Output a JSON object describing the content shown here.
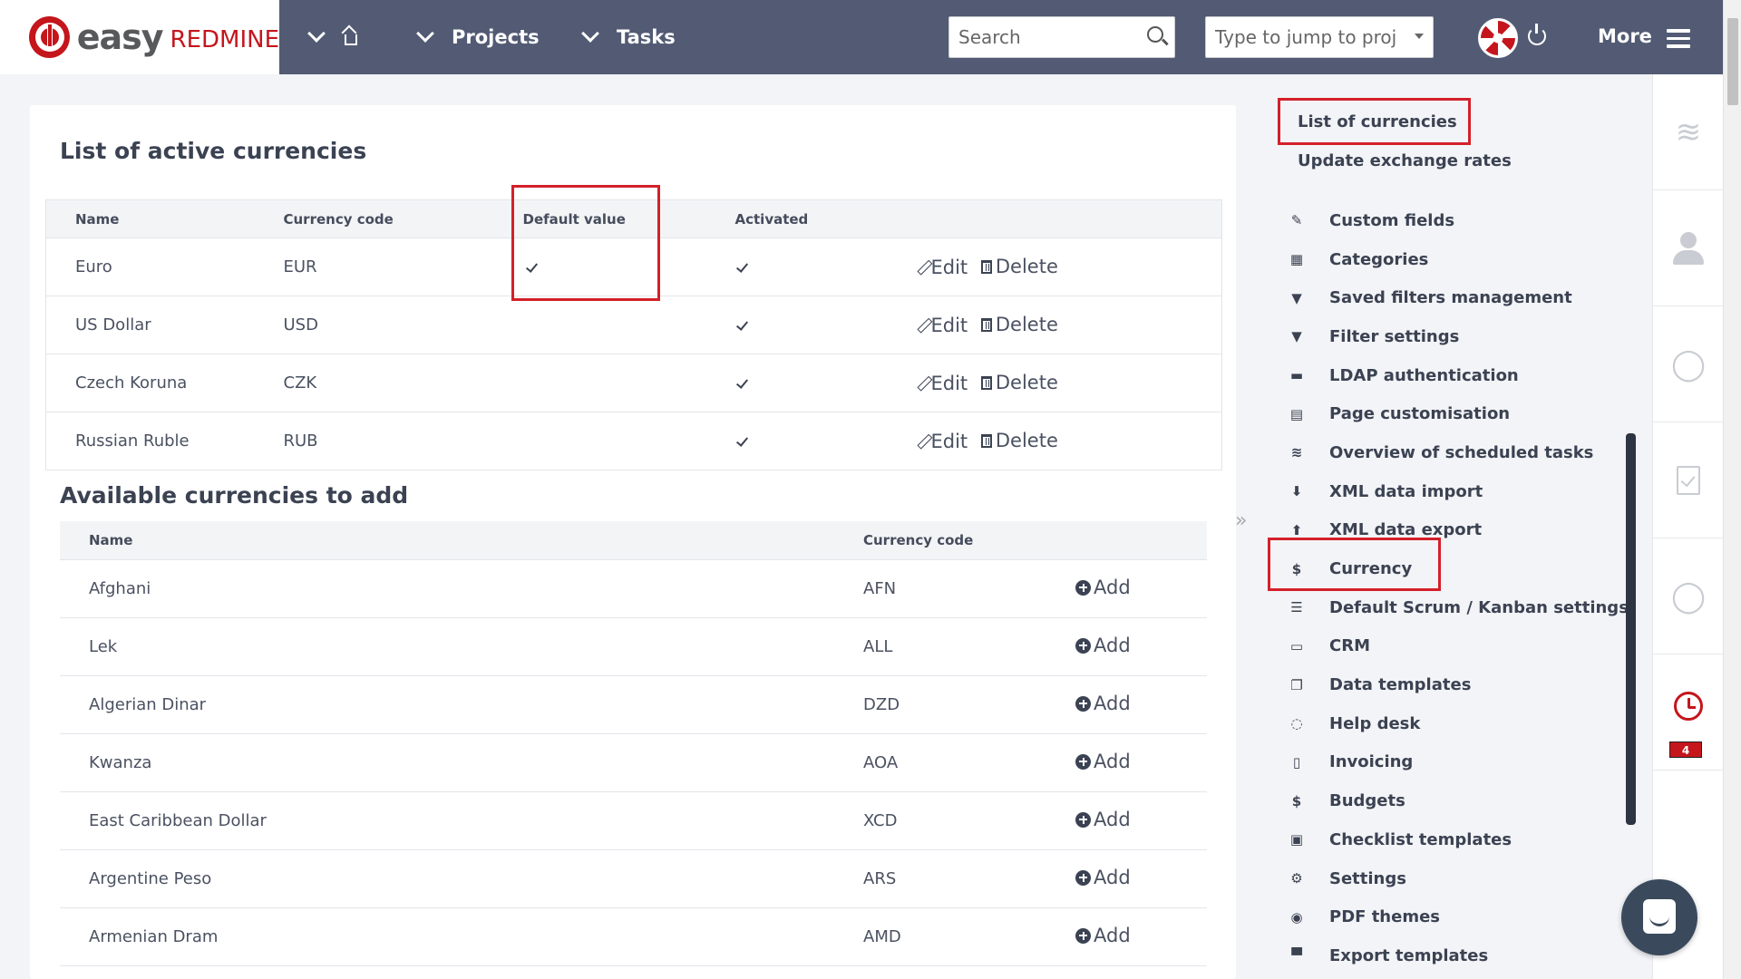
{
  "header": {
    "logo_text_easy": "easy",
    "logo_text_redmine": "REDMINE",
    "nav": [
      {
        "label": "Projects"
      },
      {
        "label": "Tasks"
      }
    ],
    "search_placeholder": "Search",
    "jump_placeholder": "Type to jump to project...",
    "more_label": "More"
  },
  "active_currencies": {
    "title": "List of active currencies",
    "columns": {
      "name": "Name",
      "code": "Currency code",
      "default": "Default value",
      "activated": "Activated"
    },
    "rows": [
      {
        "name": "Euro",
        "code": "EUR",
        "default": true,
        "activated": true
      },
      {
        "name": "US Dollar",
        "code": "USD",
        "default": false,
        "activated": true
      },
      {
        "name": "Czech Koruna",
        "code": "CZK",
        "default": false,
        "activated": true
      },
      {
        "name": "Russian Ruble",
        "code": "RUB",
        "default": false,
        "activated": true
      }
    ],
    "edit_label": "Edit",
    "delete_label": "Delete"
  },
  "available_currencies": {
    "title": "Available currencies to add",
    "columns": {
      "name": "Name",
      "code": "Currency code"
    },
    "rows": [
      {
        "name": "Afghani",
        "code": "AFN"
      },
      {
        "name": "Lek",
        "code": "ALL"
      },
      {
        "name": "Algerian Dinar",
        "code": "DZD"
      },
      {
        "name": "Kwanza",
        "code": "AOA"
      },
      {
        "name": "East Caribbean Dollar",
        "code": "XCD"
      },
      {
        "name": "Argentine Peso",
        "code": "ARS"
      },
      {
        "name": "Armenian Dram",
        "code": "AMD"
      }
    ],
    "add_label": "Add"
  },
  "sidebar": {
    "top_links": [
      {
        "label": "List of currencies"
      },
      {
        "label": "Update exchange rates"
      }
    ],
    "items": [
      {
        "label": "Custom fields",
        "icon": "edit-icon"
      },
      {
        "label": "Categories",
        "icon": "grid-icon"
      },
      {
        "label": "Saved filters management",
        "icon": "filter-icon"
      },
      {
        "label": "Filter settings",
        "icon": "filter-icon"
      },
      {
        "label": "LDAP authentication",
        "icon": "ldap-icon"
      },
      {
        "label": "Page customisation",
        "icon": "page-icon"
      },
      {
        "label": "Overview of scheduled tasks",
        "icon": "stack-icon"
      },
      {
        "label": "XML data import",
        "icon": "download-icon"
      },
      {
        "label": "XML data export",
        "icon": "upload-icon"
      },
      {
        "label": "Currency",
        "icon": "dollar-icon"
      },
      {
        "label": "Default Scrum / Kanban settings",
        "icon": "list-icon"
      },
      {
        "label": "CRM",
        "icon": "folder-icon"
      },
      {
        "label": "Data templates",
        "icon": "copy-icon"
      },
      {
        "label": "Help desk",
        "icon": "helpdesk-icon"
      },
      {
        "label": "Invoicing",
        "icon": "invoice-icon"
      },
      {
        "label": "Budgets",
        "icon": "dollar-icon"
      },
      {
        "label": "Checklist templates",
        "icon": "checklist-icon"
      },
      {
        "label": "Settings",
        "icon": "gear-icon"
      },
      {
        "label": "PDF themes",
        "icon": "eye-icon"
      },
      {
        "label": "Export templates",
        "icon": "print-icon"
      }
    ]
  },
  "rail": {
    "history_badge": "4"
  },
  "colors": {
    "topbar": "#525b73",
    "brand_red": "#c4161c",
    "highlight": "#d3202a"
  }
}
